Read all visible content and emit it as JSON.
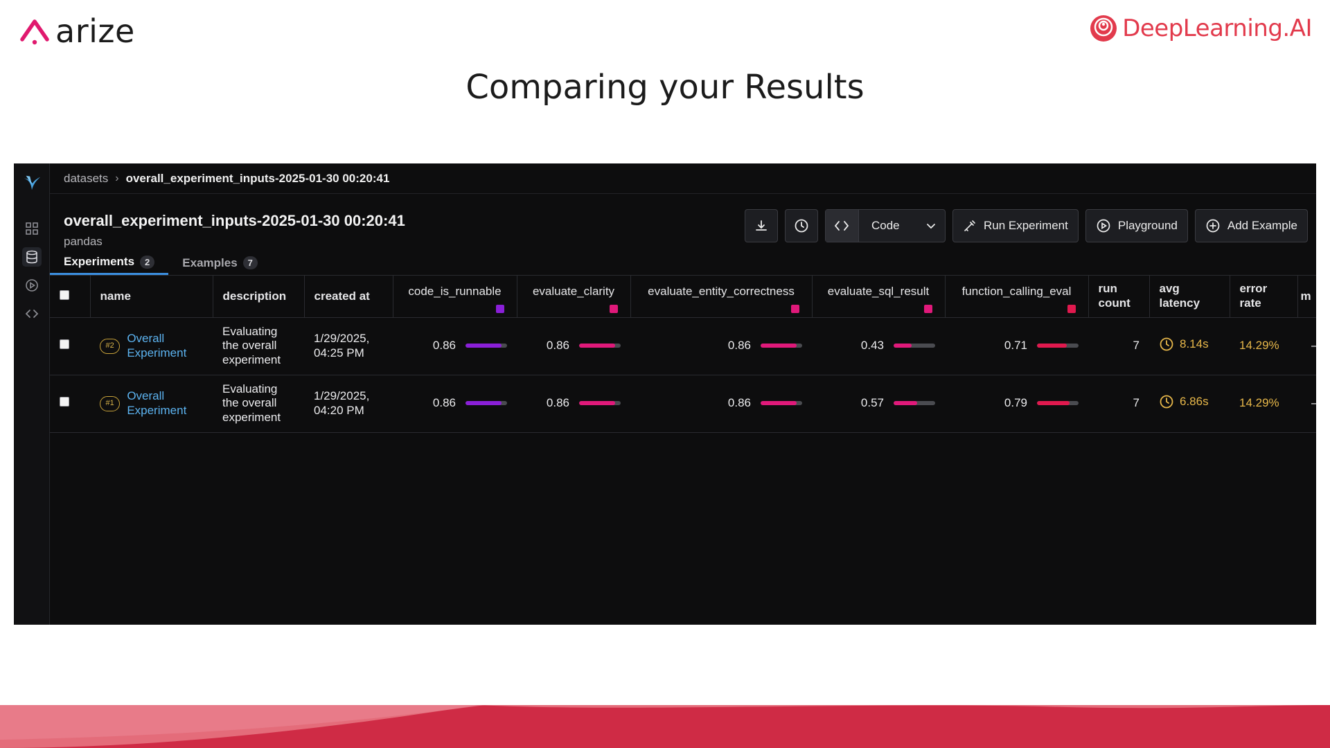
{
  "slide": {
    "title": "Comparing your Results",
    "arize_logo": "arize",
    "dl_logo": "DeepLearning.AI",
    "brand_colors": {
      "arize_pink": "#e0196e",
      "dl_red": "#e23a4c",
      "wave": "#d6344b"
    }
  },
  "app": {
    "breadcrumb": {
      "root": "datasets",
      "current": "overall_experiment_inputs-2025-01-30 00:20:41"
    },
    "dataset": {
      "title": "overall_experiment_inputs-2025-01-30 00:20:41",
      "subtitle": "pandas"
    },
    "toolbar": {
      "download_icon": "download-icon",
      "history_icon": "clock-icon",
      "code_label": "Code",
      "run_experiment_label": "Run Experiment",
      "playground_label": "Playground",
      "add_example_label": "Add Example"
    },
    "tabs": [
      {
        "label": "Experiments",
        "count": "2",
        "active": true
      },
      {
        "label": "Examples",
        "count": "7",
        "active": false
      }
    ],
    "columns": {
      "name": "name",
      "description": "description",
      "created_at": "created at",
      "m1": "code_is_runnable",
      "m2": "evaluate_clarity",
      "m3": "evaluate_entity_correctness",
      "m4": "evaluate_sql_result",
      "m5": "function_calling_eval",
      "run_count": "run count",
      "avg_latency": "avg latency",
      "error_rate": "error rate",
      "more": "m"
    },
    "metric_colors": [
      "#8a1fd8",
      "#e0197a",
      "#e0197a",
      "#e0197a",
      "#e0194e"
    ],
    "rows": [
      {
        "tag": "#2",
        "name": "Overall Experiment",
        "description": "Evaluating the overall experiment",
        "created_at": "1/29/2025, 04:25 PM",
        "m1": "0.86",
        "m2": "0.86",
        "m3": "0.86",
        "m4": "0.43",
        "m5": "0.71",
        "fills": [
          0.86,
          0.86,
          0.86,
          0.43,
          0.71
        ],
        "run_count": "7",
        "avg_latency": "8.14s",
        "error_rate": "14.29%",
        "more": "–"
      },
      {
        "tag": "#1",
        "name": "Overall Experiment",
        "description": "Evaluating the overall experiment",
        "created_at": "1/29/2025, 04:20 PM",
        "m1": "0.86",
        "m2": "0.86",
        "m3": "0.86",
        "m4": "0.57",
        "m5": "0.79",
        "fills": [
          0.86,
          0.86,
          0.86,
          0.57,
          0.79
        ],
        "run_count": "7",
        "avg_latency": "6.86s",
        "error_rate": "14.29%",
        "more": "–"
      }
    ]
  }
}
